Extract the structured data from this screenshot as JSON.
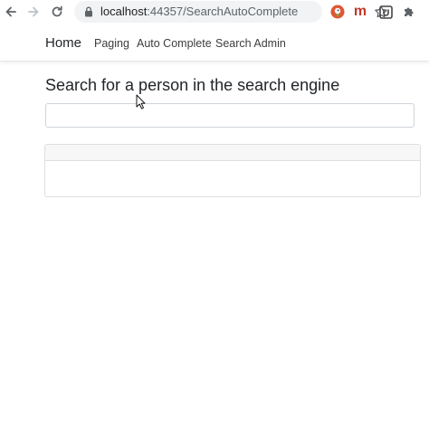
{
  "browser": {
    "url_host": "localhost",
    "url_path": ":44357/SearchAutoComplete",
    "extensions": [
      {
        "icon": "duckduckgo-icon"
      },
      {
        "icon": "m-extension-icon",
        "label": "m"
      },
      {
        "icon": "u-extension-icon"
      },
      {
        "icon": "puzzle-icon"
      }
    ]
  },
  "navbar": {
    "brand": "Home",
    "links": [
      "Paging",
      "Auto Complete",
      "Search Admin"
    ]
  },
  "main": {
    "heading": "Search for a person in the search engine",
    "search_value": ""
  },
  "colors": {
    "extension_m": "#c0392b",
    "duckduckgo": "#de5833"
  }
}
